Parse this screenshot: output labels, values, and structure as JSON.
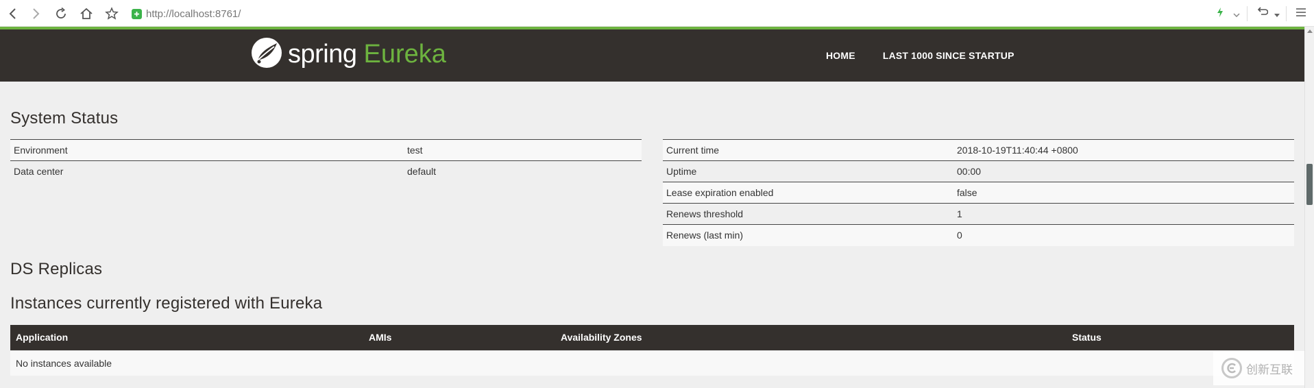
{
  "browser": {
    "url_host": "http://localhost",
    "url_port": ":8761/"
  },
  "header": {
    "logo_spring": "spring",
    "logo_eureka": "Eureka",
    "nav": [
      "HOME",
      "LAST 1000 SINCE STARTUP"
    ]
  },
  "system_status": {
    "title": "System Status",
    "left": [
      {
        "key": "Environment",
        "value": "test"
      },
      {
        "key": "Data center",
        "value": "default"
      }
    ],
    "right": [
      {
        "key": "Current time",
        "value": "2018-10-19T11:40:44 +0800"
      },
      {
        "key": "Uptime",
        "value": "00:00"
      },
      {
        "key": "Lease expiration enabled",
        "value": "false"
      },
      {
        "key": "Renews threshold",
        "value": "1"
      },
      {
        "key": "Renews (last min)",
        "value": "0"
      }
    ]
  },
  "replicas": {
    "title": "DS Replicas"
  },
  "instances": {
    "title": "Instances currently registered with Eureka",
    "columns": [
      "Application",
      "AMIs",
      "Availability Zones",
      "Status"
    ],
    "empty_message": "No instances available"
  },
  "watermark": {
    "text": "创新互联"
  },
  "colors": {
    "header_bg": "#34302d",
    "spring_green": "#6db33f",
    "page_bg": "#efefef"
  }
}
